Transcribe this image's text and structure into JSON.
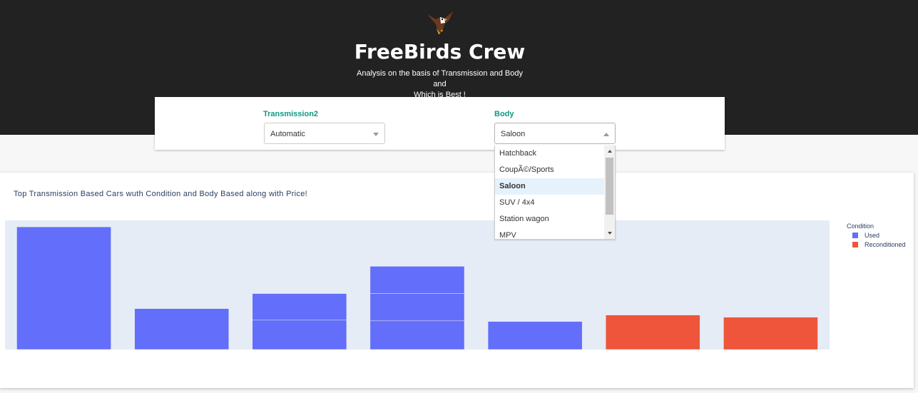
{
  "header": {
    "logo_icon": "eagle-icon",
    "title": "FreeBirds Crew",
    "subtitle_line1": "Analysis on the basis of Transmission and Body and",
    "subtitle_line2": "Which is Best !",
    "background_color": "#222222"
  },
  "controls": {
    "transmission": {
      "label": "Transmission2",
      "value": "Automatic"
    },
    "body": {
      "label": "Body",
      "value": "Saloon",
      "options": [
        "Hatchback",
        "CoupÃ©/Sports",
        "Saloon",
        "SUV / 4x4",
        "Station wagon",
        "MPV"
      ]
    },
    "label_color": "#0f9a80"
  },
  "chart": {
    "title": "Top Transmission Based Cars wuth Condition and Body Based along with Price!",
    "legend_title": "Condition",
    "legend": [
      {
        "name": "Used",
        "color": "#636efa"
      },
      {
        "name": "Reconditioned",
        "color": "#ef553b"
      }
    ]
  },
  "chart_data": {
    "type": "bar",
    "barmode": "stack",
    "title": "Top Transmission Based Cars wuth Condition and Body Based along with Price!",
    "xlabel": "",
    "ylabel": "",
    "grid": false,
    "legend_title": "Condition",
    "legend_position": "top-right",
    "plot_background": "#e5ecf6",
    "ylim": [
      0,
      180
    ],
    "bars": [
      {
        "condition": "Used",
        "stack": [
          171
        ]
      },
      {
        "condition": "Used",
        "stack": [
          57
        ]
      },
      {
        "condition": "Used",
        "stack": [
          41,
          37
        ]
      },
      {
        "condition": "Used",
        "stack": [
          40,
          38,
          38
        ]
      },
      {
        "condition": "Used",
        "stack": [
          39
        ]
      },
      {
        "condition": "Reconditioned",
        "stack": [
          48
        ]
      },
      {
        "condition": "Reconditioned",
        "stack": [
          45
        ]
      }
    ]
  }
}
